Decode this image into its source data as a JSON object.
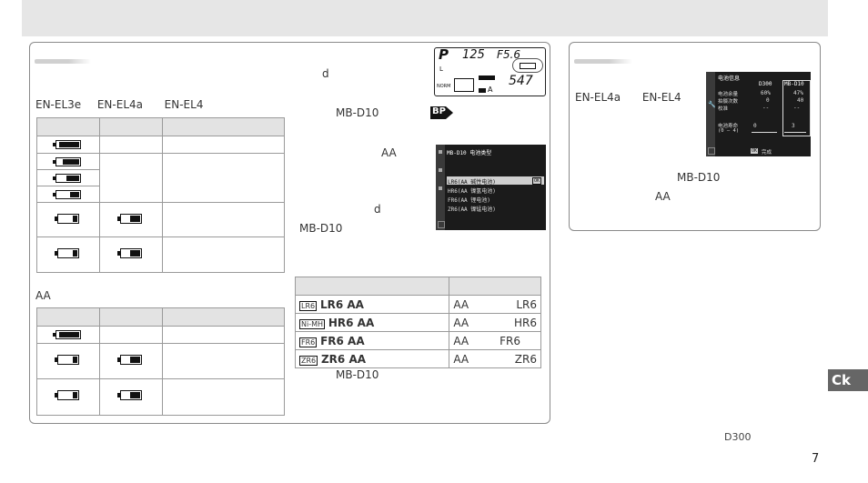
{
  "left": {
    "text_d": "d",
    "text_mbd10_top": "MB-D10",
    "bp_label": "BP",
    "text_aa_mid": "AA",
    "text_d_lower": "d",
    "text_mbd10_mid": "MB-D10",
    "liion_heading": [
      "EN-EL3e",
      "EN-EL4a",
      "EN-EL4"
    ],
    "aa_heading": "AA",
    "lcd": {
      "mode": "P",
      "shutter": "125",
      "aperture": "F5.6",
      "l": "L",
      "norm": "NORM",
      "count": "547",
      "k": "A"
    },
    "menu": {
      "title": "MB-D10 电池类型",
      "items": [
        {
          "code": "LR6",
          "text": "LR6(AA 碱性电池)",
          "ok": "OK"
        },
        {
          "code": "HR6",
          "text": "HR6(AA 镍氢电池)"
        },
        {
          "code": "FR6",
          "text": "FR6(AA 锂电池)"
        },
        {
          "code": "ZR6",
          "text": "ZR6(AA 镍锰电池)"
        }
      ]
    },
    "type_table": [
      {
        "code": "LR6",
        "name": "LR6  AA",
        "desc": "AA",
        "val": "LR6"
      },
      {
        "code": "Ni-MH",
        "name": "HR6  AA",
        "desc": "AA",
        "val": "HR6"
      },
      {
        "code": "FR6",
        "name": "FR6  AA",
        "desc": "AA",
        "val": "FR6"
      },
      {
        "code": "ZR6",
        "name": "ZR6  AA",
        "desc": "AA",
        "val": "ZR6"
      }
    ],
    "text_mbd10_bottom": "MB-D10"
  },
  "right": {
    "models": [
      "EN-EL4a",
      "EN-EL4"
    ],
    "text_mbd10": "MB-D10",
    "text_aa": "AA",
    "screen": {
      "title": "电池信息",
      "col1": "D300",
      "col2": "MB-D10",
      "rows": [
        {
          "label": "电池余量",
          "v1": "60%",
          "v2": "47%"
        },
        {
          "label": "拍摄次数",
          "v1": "0",
          "v2": "40"
        },
        {
          "label": "校准",
          "v1": "--",
          "v2": "--"
        }
      ],
      "life_label": "电池寿命",
      "life_range": "(0 – 4)",
      "life_v1": "0",
      "life_v2": "3",
      "ok_text": "完成",
      "ok_key": "OK"
    }
  },
  "side_tab": "Ck",
  "footer": {
    "model": "D300",
    "page": "7"
  }
}
